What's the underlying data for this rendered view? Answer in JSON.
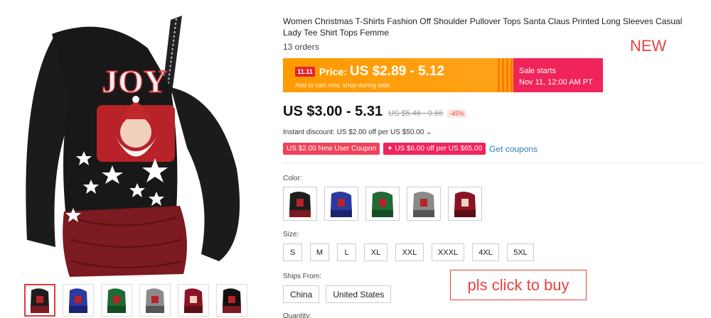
{
  "product": {
    "title": "Women Christmas T-Shirts Fashion Off Shoulder Pullover Tops Santa Claus Printed Long Sleeves Casual Lady Tee Shirt Tops Femme",
    "orders": "13 orders",
    "new_label": "NEW"
  },
  "promo": {
    "badge": "11.11",
    "price_label": "Price:",
    "price": "US $2.89 - 5.12",
    "subtext": "Add to cart now, shop during sale",
    "sale_starts": "Sale starts",
    "sale_date": "Nov 11, 12:00 AM PT"
  },
  "pricing": {
    "price": "US $3.00 - 5.31",
    "old_price": "US $5.46 - 9.66",
    "discount": "-45%"
  },
  "instant_discount": "Instant discount: US $2.00 off per US $50.00 ⌄",
  "coupons": {
    "new_user": "US $2.00 New User Coupon",
    "store": "✦ US $6.00 off per US $65.00",
    "get": "Get coupons"
  },
  "color": {
    "label": "Color:",
    "options": [
      {
        "name": "black",
        "hex": "#1d1d1d"
      },
      {
        "name": "blue",
        "hex": "#2a3aa0"
      },
      {
        "name": "green",
        "hex": "#1f6b35"
      },
      {
        "name": "gray",
        "hex": "#8a8a8a"
      },
      {
        "name": "wine-red",
        "hex": "#8a1424"
      }
    ]
  },
  "size": {
    "label": "Size:",
    "options": [
      "S",
      "M",
      "L",
      "XL",
      "XXL",
      "XXXL",
      "4XL",
      "5XL"
    ]
  },
  "ships": {
    "label": "Ships From:",
    "options": [
      "China",
      "United States"
    ]
  },
  "buy_label": "pls click to buy",
  "quantity_label": "Quantity:",
  "thumbnails": [
    {
      "hex": "#1d1d1d"
    },
    {
      "hex": "#2a3aa0"
    },
    {
      "hex": "#1f6b35"
    },
    {
      "hex": "#8a8a8a"
    },
    {
      "hex": "#8a1424"
    },
    {
      "hex": "#111111"
    }
  ]
}
